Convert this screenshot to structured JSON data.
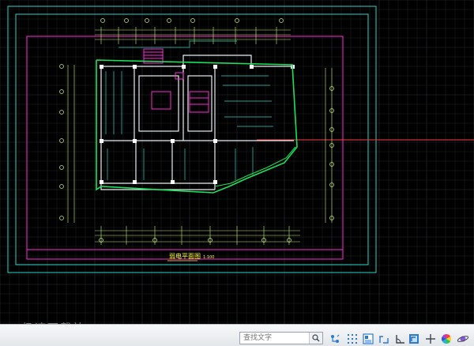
{
  "drawing": {
    "title": "弱电平面图",
    "scale": "1:100"
  },
  "watermark": "极速下载站",
  "statusbar": {
    "search_placeholder": "查找文字",
    "tools": [
      {
        "name": "snap-icon"
      },
      {
        "name": "grid-icon"
      },
      {
        "name": "properties-icon"
      },
      {
        "name": "orthogonal-icon"
      },
      {
        "name": "angle-icon"
      },
      {
        "name": "drawing-view-icon"
      },
      {
        "name": "crosshair-icon"
      },
      {
        "name": "color-wheel-icon"
      },
      {
        "name": "orbit-icon"
      }
    ]
  },
  "colors": {
    "canvas": "#000000",
    "grid": "#2a2d32",
    "frame": "#2ad3c6",
    "magenta": "#ff2ad8",
    "wall": "#e9eef2",
    "cable": "#19e15a",
    "dimension": "#c9f26a",
    "annotation": "#ff3a4a"
  }
}
